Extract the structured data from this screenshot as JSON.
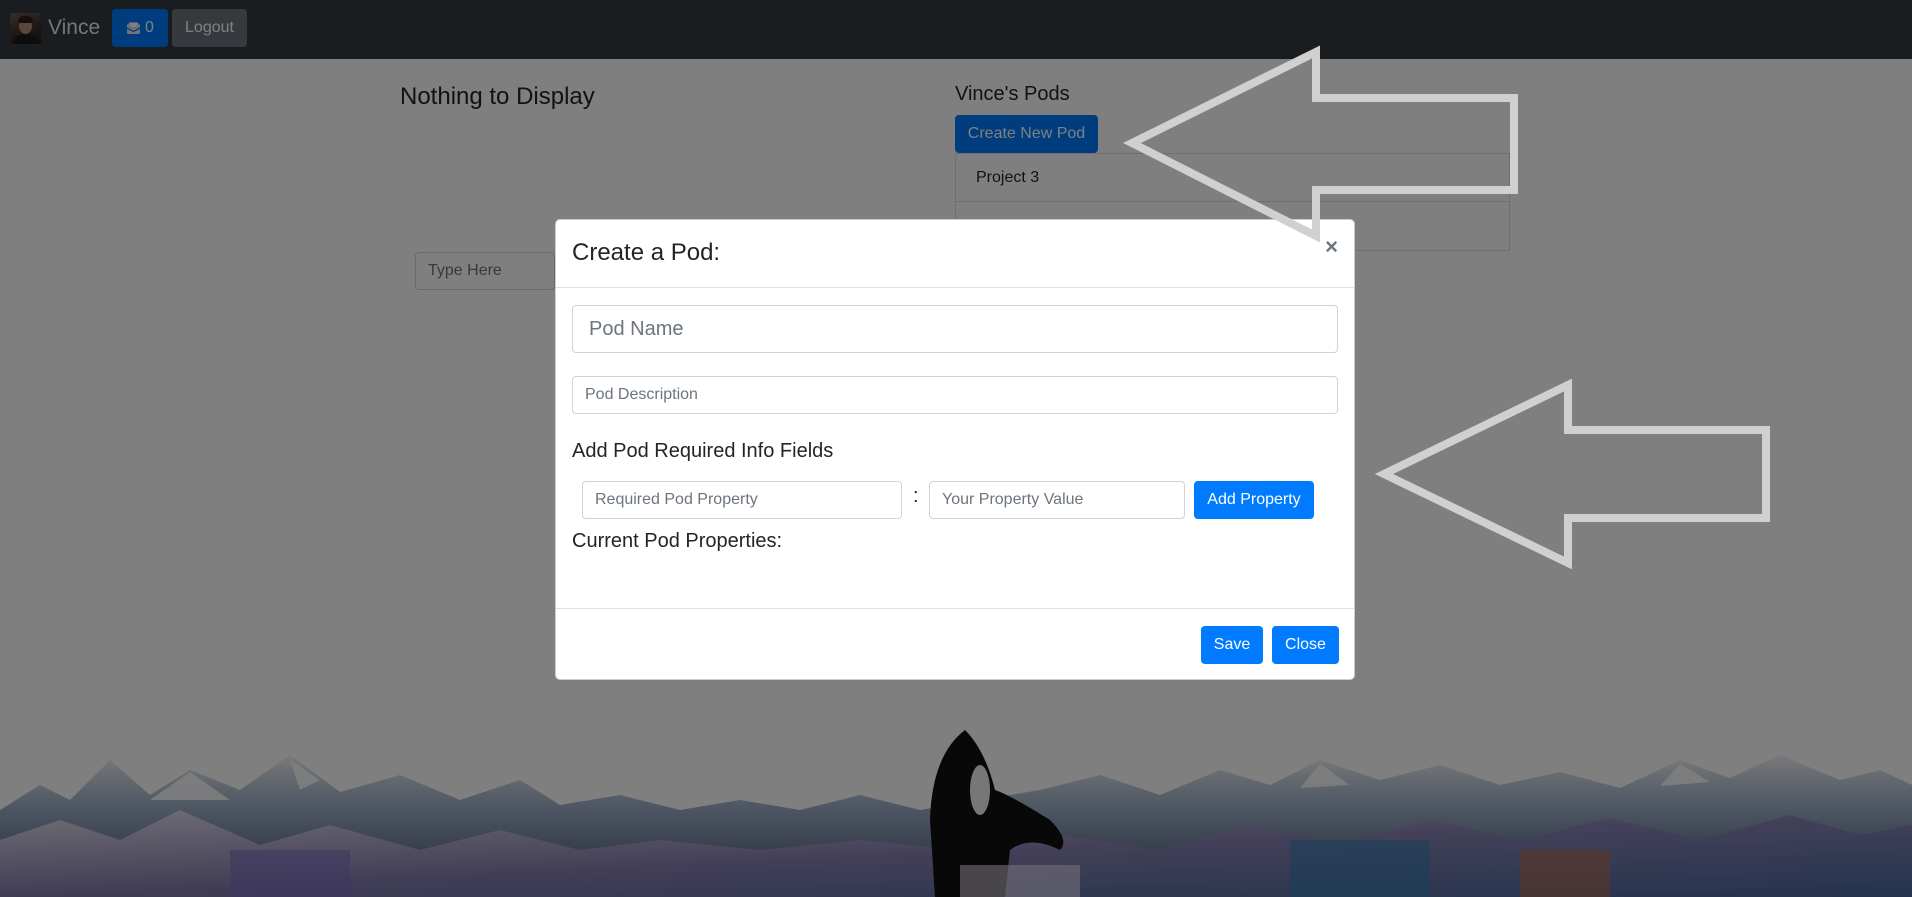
{
  "navbar": {
    "user_name": "Vince",
    "message_count": "0",
    "logout_label": "Logout"
  },
  "page": {
    "empty_title": "Nothing to Display",
    "pods_heading": "Vince's Pods",
    "create_pod_label": "Create New Pod",
    "pods": [
      "Project 3",
      ""
    ],
    "search_placeholder": "Type Here"
  },
  "modal": {
    "title": "Create a Pod:",
    "close_symbol": "×",
    "pod_name_placeholder": "Pod Name",
    "pod_description_placeholder": "Pod Description",
    "required_fields_heading": "Add Pod Required Info Fields",
    "property_placeholder": "Required Pod Property",
    "separator": ":",
    "value_placeholder": "Your Property Value",
    "add_property_label": "Add Property",
    "current_properties_heading": "Current Pod Properties:",
    "save_label": "Save",
    "close_label": "Close"
  },
  "colors": {
    "navbar": "#343a40",
    "primary": "#007bff",
    "secondary": "#6c757d",
    "arrow_outline": "#d0d0d0"
  },
  "icons": {
    "message": "envelope-icon",
    "close": "close-icon",
    "annotation": "arrow-left-icon"
  }
}
